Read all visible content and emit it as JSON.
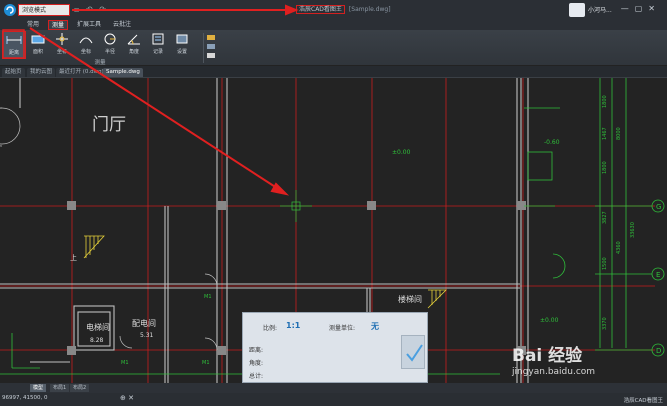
{
  "titlebar": {
    "mode": "浏览模式",
    "app_name": "浩辰CAD看图王",
    "file_name": "[Sample.dwg]",
    "user": "小河马..."
  },
  "tabs": [
    "常用",
    "测量",
    "扩展工具",
    "云批注"
  ],
  "active_tab": "测量",
  "ribbon": {
    "buttons": [
      {
        "label": "距离",
        "icon": "distance-icon"
      },
      {
        "label": "面积",
        "icon": "area-icon"
      },
      {
        "label": "坐标",
        "icon": "coordinate-icon"
      },
      {
        "label": "坐标",
        "icon": "arc-icon"
      },
      {
        "label": "半径",
        "icon": "radius-icon"
      },
      {
        "label": "角度",
        "icon": "angle-icon"
      },
      {
        "label": "记录",
        "icon": "record-icon"
      },
      {
        "label": "设置",
        "icon": "settings-icon"
      }
    ],
    "group_label": "测量"
  },
  "doc_tabs": [
    "起始页",
    "我的云图",
    "最近打开 (0.dwg)",
    "Sample.dwg"
  ],
  "drawing": {
    "room_label": "门厅",
    "elevator": "电梯间",
    "elevator_area": "8.28",
    "power_room": "配电间",
    "power_area": "5.31",
    "stair_label": "楼梯间",
    "up_label": "上",
    "level1": "±0.00",
    "level2": "-0.60",
    "level3": "±0.00",
    "m1": "M1",
    "dims": [
      "1800",
      "1467",
      "8000",
      "1800",
      "3827",
      "4360",
      "33630",
      "1500",
      "3370"
    ],
    "axis_bubbles": [
      "G",
      "E",
      "D"
    ]
  },
  "measure": {
    "scale_label": "比例:",
    "scale_value": "1:1",
    "unit_label": "测量单位:",
    "unit_value": "无",
    "distance_label": "距离:",
    "angle_label": "角度:",
    "total_label": "总计:"
  },
  "layout_tabs": [
    "模型",
    "布局1",
    "布局2"
  ],
  "statusbar": {
    "coords": "96997, 41500, 0",
    "right": "浩辰CAD看图王"
  },
  "watermark": {
    "logo": "Bai 经验",
    "url": "jingyan.baidu.com"
  },
  "colors": {
    "grid_red": "#c81e1e",
    "cad_green": "#2fbf3a",
    "annotation_red": "#e02020"
  }
}
